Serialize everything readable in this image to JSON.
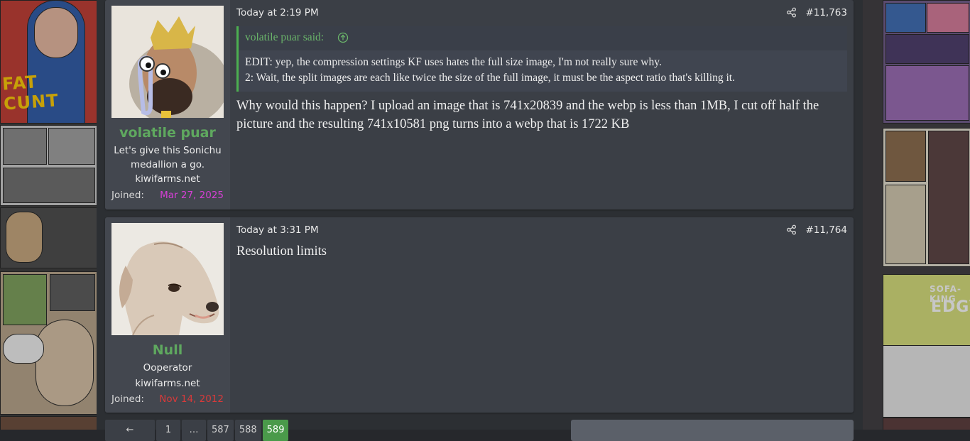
{
  "posts": [
    {
      "username": "volatile puar",
      "user_title": "Let's give this Sonichu medallion a go.",
      "user_banner": "kiwifarms.net",
      "joined_label": "Joined:",
      "joined_date": "Mar 27, 2025",
      "joined_color": "#d63fd6",
      "time": "Today at 2:19 PM",
      "post_number": "#11,763",
      "quote": {
        "author": "volatile puar said:",
        "lines": [
          "EDIT: yep, the compression settings KF uses hates the full size image, I'm not really sure why.",
          "2: Wait, the split images are each like twice the size of the full image, it must be the aspect ratio that's killing it."
        ]
      },
      "body": "Why would this happen? I upload an image that is 741x20839 and the webp is less than 1MB, I cut off half the picture and the resulting 741x10581 png turns into a webp that is 1722 KB"
    },
    {
      "username": "Null",
      "user_title": "Ooperator",
      "user_banner": "kiwifarms.net",
      "joined_label": "Joined:",
      "joined_date": "Nov 14, 2012",
      "joined_color": "#d83a3a",
      "time": "Today at 3:31 PM",
      "post_number": "#11,764",
      "body": "Resolution limits"
    }
  ],
  "pagination": {
    "items": [
      "←",
      "1",
      "…",
      "587",
      "588",
      "589"
    ],
    "current": "589"
  },
  "colors": {
    "accent": "#5fa85f",
    "post_bg": "#3b3f46",
    "user_panel_bg": "#43474f",
    "page_bg": "#2c2f33"
  },
  "icons": {
    "share": "share-icon",
    "quote_jump": "arrow-up-circle-icon"
  }
}
